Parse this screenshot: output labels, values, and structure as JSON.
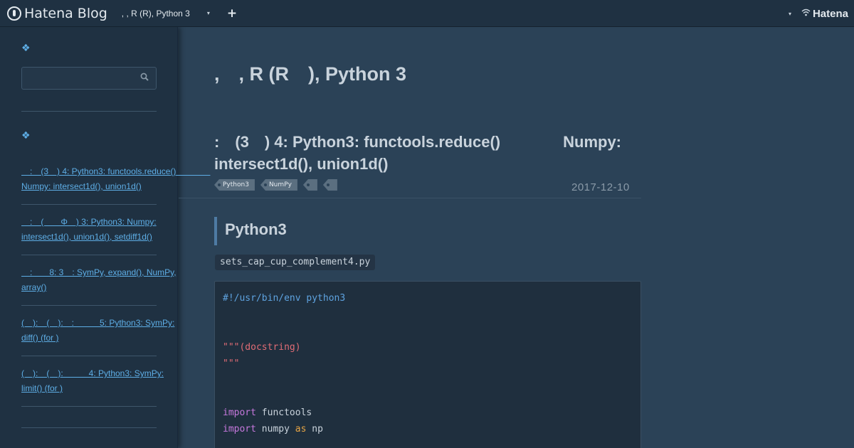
{
  "header": {
    "logo_text": "Hatena Blog",
    "blog_title": ", , R (R), Python 3",
    "caret": "▾",
    "add": "+",
    "right_caret": "▾",
    "hatena_text": "Hatena"
  },
  "sidebar": {
    "heading1": "❖",
    "search_placeholder": "",
    "heading2": "❖",
    "items": [
      {
        "label": "　:　(3　) 4: Python3: functools.reduce()　　　　Numpy: intersect1d(), union1d()"
      },
      {
        "label": "　:　(　　Φ　) 3: Python3: Numpy: intersect1d(), union1d(), setdiff1d()"
      },
      {
        "label": "　:　　8: 3　: SymPy, expand(), NumPy, array()"
      },
      {
        "label": "(　):　(　):　:　　　5: Python3: SymPy: diff() (for )"
      },
      {
        "label": "(　):　(　):　　　4: Python3: SymPy: limit() (for )"
      }
    ]
  },
  "main": {
    "blog_title": ",　, R (R　), Python 3",
    "entry_title_line1": ":　(3　) 4: Python3: functools.reduce()　　　　Numpy:",
    "entry_title_line2": "intersect1d(), union1d()",
    "tags": [
      "Python3",
      "NumPy",
      "",
      ""
    ],
    "date": "2017-12-10",
    "section_heading": "Python3",
    "filename": "sets_cap_cup_complement4.py",
    "code": {
      "line1": "#!/usr/bin/env python3",
      "line4_q": "\"\"\"(docstring)",
      "line5_q": "\"\"\"",
      "kw_import": "import",
      "mod_functools": " functools",
      "mod_numpy": " numpy ",
      "kw_as": "as",
      "alias_np": " np"
    }
  },
  "colors": {
    "background": "#2b4257",
    "sidebar": "#1f3142",
    "link": "#5eaee6",
    "code_bg": "#1f2f3e",
    "comment": "#5ea3e0",
    "string": "#e06c75",
    "keyword": "#c678dd"
  }
}
